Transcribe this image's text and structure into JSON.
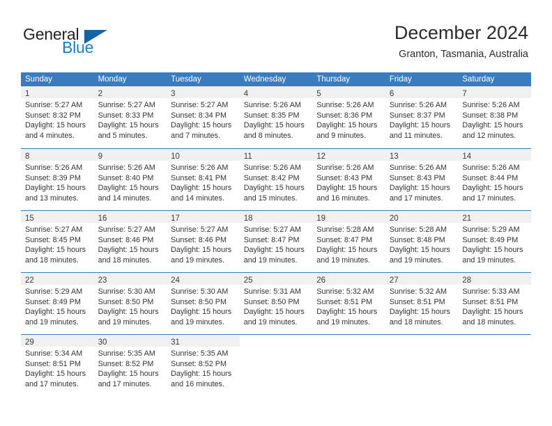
{
  "brand": {
    "name_part1": "General",
    "name_part2": "Blue"
  },
  "header": {
    "month_title": "December 2024",
    "location": "Granton, Tasmania, Australia",
    "accent_color": "#3a7cc0",
    "logo_blue": "#1a7cc1"
  },
  "weekday_headers": [
    "Sunday",
    "Monday",
    "Tuesday",
    "Wednesday",
    "Thursday",
    "Friday",
    "Saturday"
  ],
  "weeks": [
    {
      "days": [
        {
          "num": "1",
          "l1": "Sunrise: 5:27 AM",
          "l2": "Sunset: 8:32 PM",
          "l3": "Daylight: 15 hours",
          "l4": "and 4 minutes."
        },
        {
          "num": "2",
          "l1": "Sunrise: 5:27 AM",
          "l2": "Sunset: 8:33 PM",
          "l3": "Daylight: 15 hours",
          "l4": "and 5 minutes."
        },
        {
          "num": "3",
          "l1": "Sunrise: 5:27 AM",
          "l2": "Sunset: 8:34 PM",
          "l3": "Daylight: 15 hours",
          "l4": "and 7 minutes."
        },
        {
          "num": "4",
          "l1": "Sunrise: 5:26 AM",
          "l2": "Sunset: 8:35 PM",
          "l3": "Daylight: 15 hours",
          "l4": "and 8 minutes."
        },
        {
          "num": "5",
          "l1": "Sunrise: 5:26 AM",
          "l2": "Sunset: 8:36 PM",
          "l3": "Daylight: 15 hours",
          "l4": "and 9 minutes."
        },
        {
          "num": "6",
          "l1": "Sunrise: 5:26 AM",
          "l2": "Sunset: 8:37 PM",
          "l3": "Daylight: 15 hours",
          "l4": "and 11 minutes."
        },
        {
          "num": "7",
          "l1": "Sunrise: 5:26 AM",
          "l2": "Sunset: 8:38 PM",
          "l3": "Daylight: 15 hours",
          "l4": "and 12 minutes."
        }
      ]
    },
    {
      "days": [
        {
          "num": "8",
          "l1": "Sunrise: 5:26 AM",
          "l2": "Sunset: 8:39 PM",
          "l3": "Daylight: 15 hours",
          "l4": "and 13 minutes."
        },
        {
          "num": "9",
          "l1": "Sunrise: 5:26 AM",
          "l2": "Sunset: 8:40 PM",
          "l3": "Daylight: 15 hours",
          "l4": "and 14 minutes."
        },
        {
          "num": "10",
          "l1": "Sunrise: 5:26 AM",
          "l2": "Sunset: 8:41 PM",
          "l3": "Daylight: 15 hours",
          "l4": "and 14 minutes."
        },
        {
          "num": "11",
          "l1": "Sunrise: 5:26 AM",
          "l2": "Sunset: 8:42 PM",
          "l3": "Daylight: 15 hours",
          "l4": "and 15 minutes."
        },
        {
          "num": "12",
          "l1": "Sunrise: 5:26 AM",
          "l2": "Sunset: 8:43 PM",
          "l3": "Daylight: 15 hours",
          "l4": "and 16 minutes."
        },
        {
          "num": "13",
          "l1": "Sunrise: 5:26 AM",
          "l2": "Sunset: 8:43 PM",
          "l3": "Daylight: 15 hours",
          "l4": "and 17 minutes."
        },
        {
          "num": "14",
          "l1": "Sunrise: 5:26 AM",
          "l2": "Sunset: 8:44 PM",
          "l3": "Daylight: 15 hours",
          "l4": "and 17 minutes."
        }
      ]
    },
    {
      "days": [
        {
          "num": "15",
          "l1": "Sunrise: 5:27 AM",
          "l2": "Sunset: 8:45 PM",
          "l3": "Daylight: 15 hours",
          "l4": "and 18 minutes."
        },
        {
          "num": "16",
          "l1": "Sunrise: 5:27 AM",
          "l2": "Sunset: 8:46 PM",
          "l3": "Daylight: 15 hours",
          "l4": "and 18 minutes."
        },
        {
          "num": "17",
          "l1": "Sunrise: 5:27 AM",
          "l2": "Sunset: 8:46 PM",
          "l3": "Daylight: 15 hours",
          "l4": "and 19 minutes."
        },
        {
          "num": "18",
          "l1": "Sunrise: 5:27 AM",
          "l2": "Sunset: 8:47 PM",
          "l3": "Daylight: 15 hours",
          "l4": "and 19 minutes."
        },
        {
          "num": "19",
          "l1": "Sunrise: 5:28 AM",
          "l2": "Sunset: 8:47 PM",
          "l3": "Daylight: 15 hours",
          "l4": "and 19 minutes."
        },
        {
          "num": "20",
          "l1": "Sunrise: 5:28 AM",
          "l2": "Sunset: 8:48 PM",
          "l3": "Daylight: 15 hours",
          "l4": "and 19 minutes."
        },
        {
          "num": "21",
          "l1": "Sunrise: 5:29 AM",
          "l2": "Sunset: 8:49 PM",
          "l3": "Daylight: 15 hours",
          "l4": "and 19 minutes."
        }
      ]
    },
    {
      "days": [
        {
          "num": "22",
          "l1": "Sunrise: 5:29 AM",
          "l2": "Sunset: 8:49 PM",
          "l3": "Daylight: 15 hours",
          "l4": "and 19 minutes."
        },
        {
          "num": "23",
          "l1": "Sunrise: 5:30 AM",
          "l2": "Sunset: 8:50 PM",
          "l3": "Daylight: 15 hours",
          "l4": "and 19 minutes."
        },
        {
          "num": "24",
          "l1": "Sunrise: 5:30 AM",
          "l2": "Sunset: 8:50 PM",
          "l3": "Daylight: 15 hours",
          "l4": "and 19 minutes."
        },
        {
          "num": "25",
          "l1": "Sunrise: 5:31 AM",
          "l2": "Sunset: 8:50 PM",
          "l3": "Daylight: 15 hours",
          "l4": "and 19 minutes."
        },
        {
          "num": "26",
          "l1": "Sunrise: 5:32 AM",
          "l2": "Sunset: 8:51 PM",
          "l3": "Daylight: 15 hours",
          "l4": "and 19 minutes."
        },
        {
          "num": "27",
          "l1": "Sunrise: 5:32 AM",
          "l2": "Sunset: 8:51 PM",
          "l3": "Daylight: 15 hours",
          "l4": "and 18 minutes."
        },
        {
          "num": "28",
          "l1": "Sunrise: 5:33 AM",
          "l2": "Sunset: 8:51 PM",
          "l3": "Daylight: 15 hours",
          "l4": "and 18 minutes."
        }
      ]
    },
    {
      "days": [
        {
          "num": "29",
          "l1": "Sunrise: 5:34 AM",
          "l2": "Sunset: 8:51 PM",
          "l3": "Daylight: 15 hours",
          "l4": "and 17 minutes."
        },
        {
          "num": "30",
          "l1": "Sunrise: 5:35 AM",
          "l2": "Sunset: 8:52 PM",
          "l3": "Daylight: 15 hours",
          "l4": "and 17 minutes."
        },
        {
          "num": "31",
          "l1": "Sunrise: 5:35 AM",
          "l2": "Sunset: 8:52 PM",
          "l3": "Daylight: 15 hours",
          "l4": "and 16 minutes."
        },
        {
          "num": "",
          "l1": "",
          "l2": "",
          "l3": "",
          "l4": ""
        },
        {
          "num": "",
          "l1": "",
          "l2": "",
          "l3": "",
          "l4": ""
        },
        {
          "num": "",
          "l1": "",
          "l2": "",
          "l3": "",
          "l4": ""
        },
        {
          "num": "",
          "l1": "",
          "l2": "",
          "l3": "",
          "l4": ""
        }
      ]
    }
  ]
}
